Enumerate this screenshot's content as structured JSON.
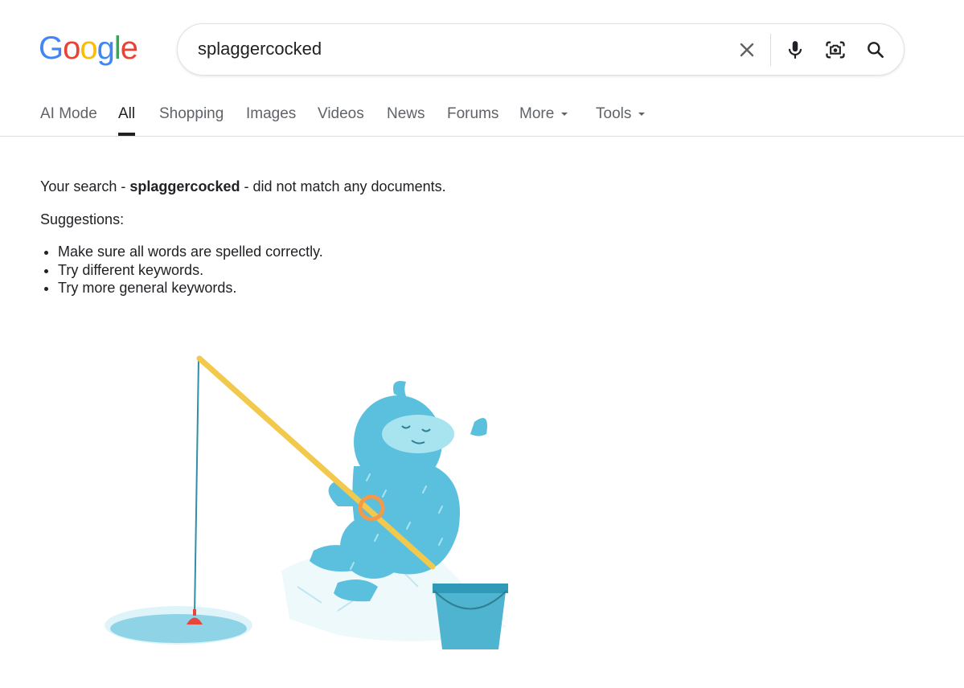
{
  "logo": {
    "letters": [
      "G",
      "o",
      "o",
      "g",
      "l",
      "e"
    ],
    "colors": [
      "#4285F4",
      "#EA4335",
      "#FBBC05",
      "#4285F4",
      "#34A853",
      "#EA4335"
    ]
  },
  "search": {
    "query": "splaggercocked"
  },
  "search_icons": [
    "clear-icon",
    "mic-icon",
    "lens-icon",
    "search-icon"
  ],
  "tabs": [
    {
      "label": "AI Mode"
    },
    {
      "label": "All",
      "active": true
    },
    {
      "label": "Shopping"
    },
    {
      "label": "Images"
    },
    {
      "label": "Videos"
    },
    {
      "label": "News"
    },
    {
      "label": "Forums"
    },
    {
      "label": "More",
      "dropdown": true
    },
    {
      "label": "Tools",
      "dropdown": true
    }
  ],
  "results": {
    "prefix": "Your search - ",
    "term": "splaggercocked",
    "suffix": " - did not match any documents.",
    "suggestions_heading": "Suggestions:",
    "suggestions": [
      "Make sure all words are spelled correctly.",
      "Try different keywords.",
      "Try more general keywords."
    ]
  },
  "colors": {
    "accent_blue": "#4285F4",
    "text": "#202124",
    "muted": "#5f6368",
    "creature": "#5bc0de"
  }
}
